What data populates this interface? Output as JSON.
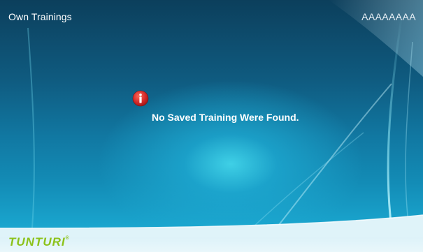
{
  "header": {
    "title": "Own Trainings",
    "user": "AAAAAAAA"
  },
  "message": {
    "icon": "info-icon",
    "text": "No Saved Training Were Found."
  },
  "footer": {
    "brand": "TUNTURI",
    "brand_mark": "®"
  },
  "colors": {
    "background_dark": "#0c3f5c",
    "background_glow": "#3fd0e6",
    "icon_red": "#d42a2a",
    "footer_bg": "#e3f4f9",
    "brand_green": "#8cc21a"
  }
}
